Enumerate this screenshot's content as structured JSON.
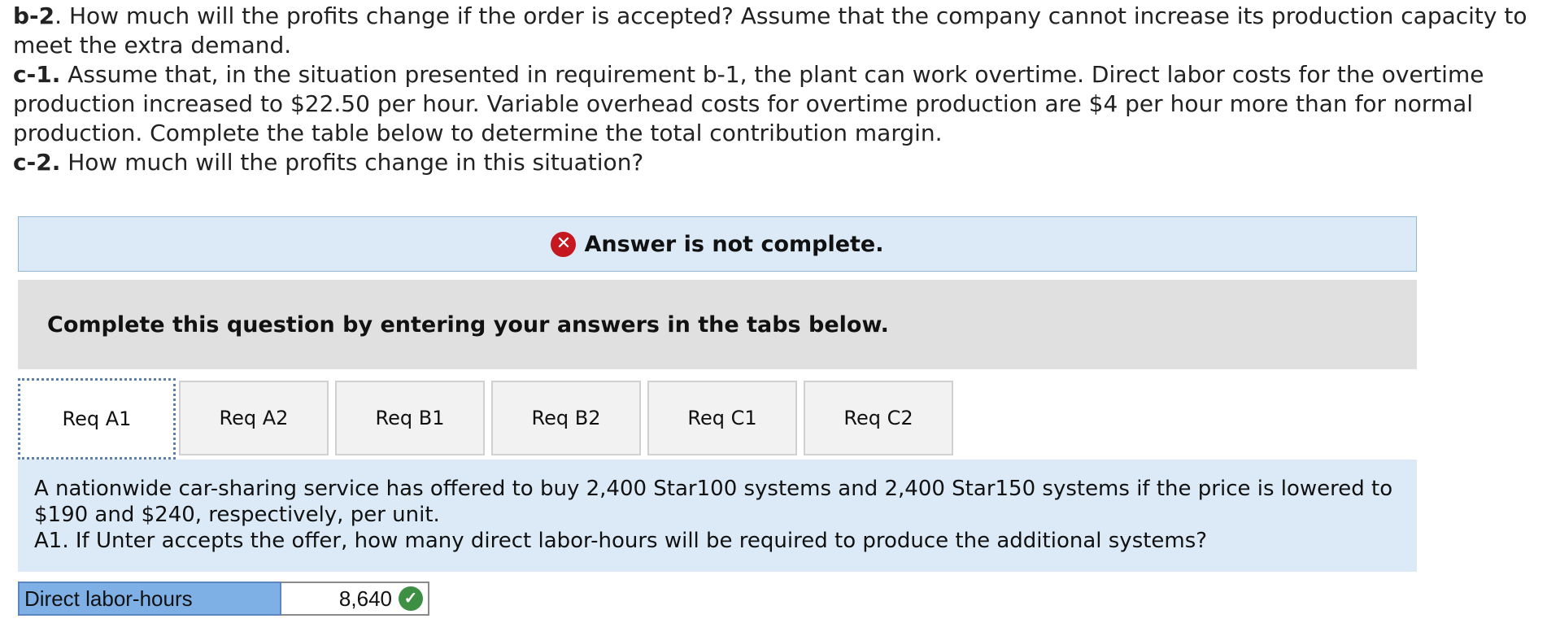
{
  "question": {
    "b2_label": "b-2",
    "b2_text": ". How much will the profits change if the order is accepted? Assume that the company cannot increase its production capacity to meet the extra demand.",
    "c1_label": "c-1.",
    "c1_text": " Assume that, in the situation presented in requirement b-1, the plant can work overtime. Direct labor costs for the overtime production increased to $22.50 per hour. Variable overhead costs for overtime production are $4 per hour more than for normal production. Complete the table below to determine the total contribution margin.",
    "c2_label": "c-2.",
    "c2_text": " How much will the profits change in this situation?"
  },
  "banner": {
    "icon": "x-circle-icon",
    "text": "Answer is not complete."
  },
  "instruction": "Complete this question by entering your answers in the tabs below.",
  "tabs": [
    {
      "label": "Req A1",
      "active": true
    },
    {
      "label": "Req A2",
      "active": false
    },
    {
      "label": "Req B1",
      "active": false
    },
    {
      "label": "Req B2",
      "active": false
    },
    {
      "label": "Req C1",
      "active": false
    },
    {
      "label": "Req C2",
      "active": false
    }
  ],
  "content": {
    "line1": "A nationwide car-sharing service has offered to buy 2,400 Star100 systems and 2,400 Star150 systems if the price is lowered to $190 and $240, respectively, per unit.",
    "line2": "A1. If Unter accepts the offer, how many direct labor-hours will be required to produce the additional systems?"
  },
  "answer": {
    "label": "Direct labor-hours",
    "value": "8,640",
    "status_icon": "check-circle-icon"
  },
  "colors": {
    "banner_bg": "#dbeaf6",
    "error_red": "#c5181f",
    "correct_green": "#3d8f43",
    "label_blue": "#7eb0e6"
  }
}
